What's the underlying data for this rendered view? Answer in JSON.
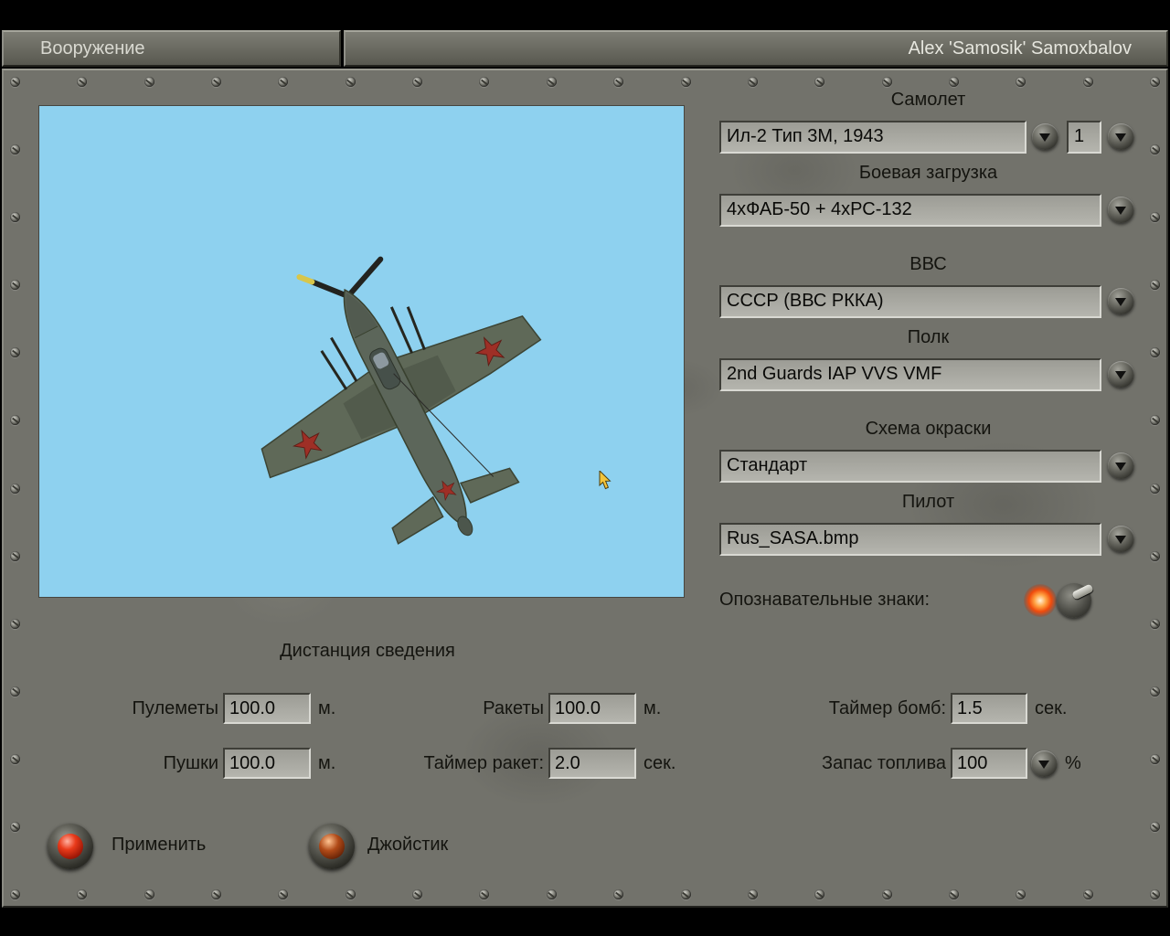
{
  "header": {
    "tab": "Вооружение",
    "player": "Alex 'Samosik' Samoxbalov"
  },
  "selectors": {
    "aircraft": {
      "label": "Самолет",
      "value": "Ил-2 Тип 3М, 1943",
      "count": "1"
    },
    "loadout": {
      "label": "Боевая загрузка",
      "value": "4xФАБ-50 + 4xРС-132"
    },
    "airforce": {
      "label": "ВВС",
      "value": "СССР (ВВС РККА)"
    },
    "regiment": {
      "label": "Полк",
      "value": "2nd Guards IAP VVS VMF"
    },
    "paint_scheme": {
      "label": "Схема окраски",
      "value": "Стандарт"
    },
    "pilot": {
      "label": "Пилот",
      "value": "Rus_SASA.bmp"
    },
    "markings": {
      "label": "Опознавательные знаки:",
      "state": "on"
    }
  },
  "convergence": {
    "title": "Дистанция сведения",
    "machine_guns": {
      "label": "Пулеметы",
      "value": "100.0",
      "unit": "м."
    },
    "cannons": {
      "label": "Пушки",
      "value": "100.0",
      "unit": "м."
    },
    "rockets": {
      "label": "Ракеты",
      "value": "100.0",
      "unit": "м."
    },
    "rocket_timer": {
      "label": "Таймер ракет:",
      "value": "2.0",
      "unit": "сек."
    },
    "bomb_timer": {
      "label": "Таймер бомб:",
      "value": "1.5",
      "unit": "сек."
    },
    "fuel": {
      "label": "Запас топлива",
      "value": "100",
      "unit": "%"
    }
  },
  "buttons": {
    "apply": "Применить",
    "joystick": "Джойстик"
  },
  "colors": {
    "panel": "#72726b",
    "sky": "#8ed1ef",
    "field": "#aaaaa3",
    "indicator_on": "#f04a0c"
  }
}
